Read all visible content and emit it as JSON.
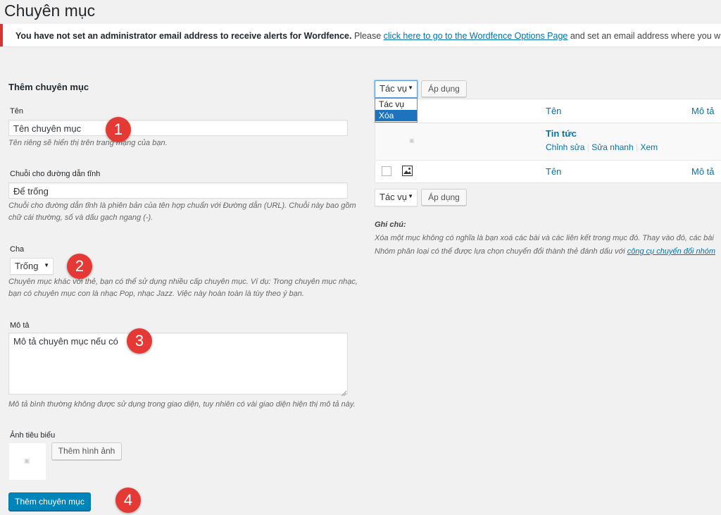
{
  "page_title": "Chuyên mục",
  "notice": {
    "bold": "You have not set an administrator email address to receive alerts for Wordfence.",
    "pre": " Please ",
    "link": "click here to go to the Wordfence Options Page",
    "post": " and set an email address where you will receive sec"
  },
  "form": {
    "title": "Thêm chuyên mục",
    "name_label": "Tên",
    "name_value": "Tên chuyên mục",
    "name_desc": "Tên riêng sẽ hiển thị trên trang mạng của bạn.",
    "slug_label": "Chuỗi cho đường dẫn tĩnh",
    "slug_value": "Để trống",
    "slug_desc_1": "Chuỗi cho đường dẫn tĩnh là phiên bản của tên hợp chuẩn với Đường dẫn (URL). Chuỗi này bao gồm",
    "slug_desc_2": "chữ cái thường, số và dấu gạch ngang (-).",
    "parent_label": "Cha",
    "parent_value": "Trống",
    "parent_desc_1": "Chuyên mục khác với thẻ, bạn có thể sử dụng nhiều cấp chuyên mục. Ví dụ: Trong chuyên mục nhạc,",
    "parent_desc_2": "bạn có chuyên mục con là nhạc Pop, nhạc Jazz. Việc này hoàn toàn là tùy theo ý bạn.",
    "desc_label": "Mô tả",
    "desc_value": "Mô tả chuyên mục nếu có",
    "desc_desc": "Mô tả bình thường không được sử dụng trong giao diện, tuy nhiên có vài giao diện hiện thị mô tả này.",
    "image_label": "Ảnh tiêu biểu",
    "add_image_button": "Thêm hình ảnh",
    "submit_button": "Thêm chuyên mục"
  },
  "markers": [
    "1",
    "2",
    "3",
    "4"
  ],
  "bulk": {
    "select_value": "Tác vụ",
    "apply_button": "Áp dụng",
    "options": [
      "Tác vụ",
      "Xóa"
    ],
    "selected_option": "Xóa"
  },
  "table": {
    "col_name": "Tên",
    "col_desc": "Mô tả",
    "rows": [
      {
        "name": "Tin tức",
        "actions": [
          "Chỉnh sửa",
          "Sửa nhanh",
          "Xem"
        ]
      }
    ],
    "footer_name": "Tên",
    "footer_desc": "Mô tả"
  },
  "notes": {
    "title": "Ghi chú:",
    "line1": "Xóa một mục không có nghĩa là bạn xoá các bài và các liên kết trong mục đó. Thay vào đó, các bài",
    "line2_pre": "Nhóm phân loại có thể được lựa chọn chuyển đổi thành thẻ đánh dấu với ",
    "line2_link": "công cụ chuyển đổi nhóm"
  },
  "colors": {
    "accent": "#0073aa",
    "primary_button": "#0085ba",
    "notice_border": "#dc3232",
    "marker": "#e53935",
    "dropdown_selected": "#1e73be"
  }
}
